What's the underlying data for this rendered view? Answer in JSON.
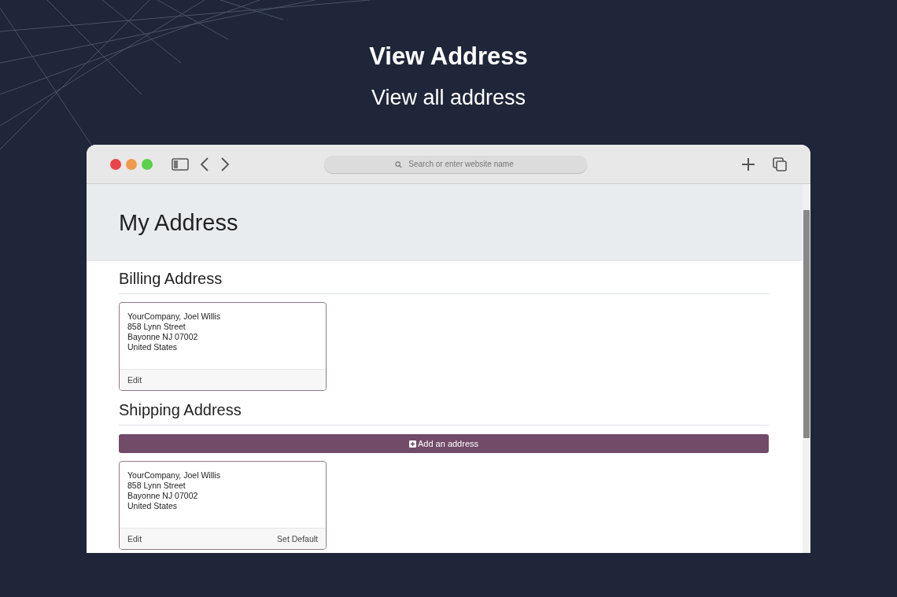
{
  "header": {
    "title": "View Address",
    "subtitle": "View all address"
  },
  "browser": {
    "address_bar": {
      "placeholder": "Search or enter website name"
    }
  },
  "page": {
    "title": "My Address",
    "sections": [
      {
        "heading": "Billing Address",
        "cards": [
          {
            "lines": [
              "YourCompany, Joel Willis",
              "858 Lynn Street",
              "Bayonne NJ 07002",
              "United States"
            ],
            "actions": [
              "Edit"
            ]
          }
        ]
      },
      {
        "heading": "Shipping Address",
        "add_button": "Add an address",
        "cards": [
          {
            "lines": [
              "YourCompany, Joel Willis",
              "858 Lynn Street",
              "Bayonne NJ 07002",
              "United States"
            ],
            "actions": [
              "Edit",
              "Set Default"
            ]
          }
        ]
      }
    ]
  }
}
